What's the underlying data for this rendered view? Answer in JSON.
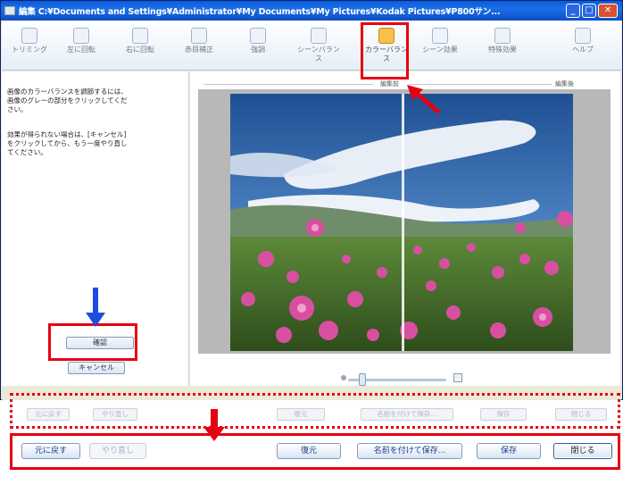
{
  "window": {
    "title": "編集 C:¥Documents and Settings¥Administrator¥My Documents¥My Pictures¥Kodak Pictures¥P800サン..."
  },
  "toolbar": {
    "items": [
      {
        "label": "トリミング"
      },
      {
        "label": "左に回転"
      },
      {
        "label": "右に回転"
      },
      {
        "label": "赤目補正"
      },
      {
        "label": "強調"
      },
      {
        "label": "シーンバランス"
      },
      {
        "label": "カラーバランス",
        "active": true
      },
      {
        "label": "シーン効果"
      },
      {
        "label": "特殊効果"
      },
      {
        "label": "ヘルプ"
      }
    ]
  },
  "left_panel": {
    "instruction_1": "画像のカラーバランスを調節するには、画像のグレーの部分をクリックしてください。",
    "instruction_2": "効果が得られない場合は、[キャンセル]をクリックしてから、もう一度やり直してください。",
    "confirm_label": "確認",
    "cancel_label": "キャンセル"
  },
  "view": {
    "before_label": "編集前",
    "after_label": "編集後"
  },
  "faded_buttons": [
    {
      "label": "元に戻す"
    },
    {
      "label": "やり直し"
    },
    {
      "label": "復元"
    },
    {
      "label": "名前を付けて保存..."
    },
    {
      "label": "保存"
    },
    {
      "label": "閉じる"
    }
  ],
  "callout_buttons": {
    "undo": "元に戻す",
    "redo": "やり直し",
    "restore": "復元",
    "save_as": "名前を付けて保存...",
    "save": "保存",
    "close": "閉じる"
  },
  "colors": {
    "highlight": "#e60012",
    "arrow_blue": "#1d4de0",
    "titlebar": "#0a5bd9"
  }
}
